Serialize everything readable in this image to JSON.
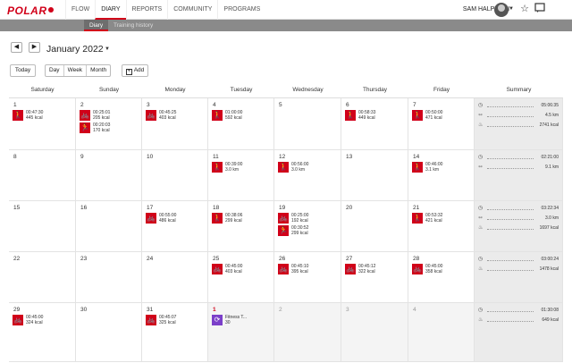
{
  "nav": {
    "logo": "POLAR",
    "items": [
      "FLOW",
      "DIARY",
      "REPORTS",
      "COMMUNITY",
      "PROGRAMS"
    ],
    "user": "SAM HALPERIN"
  },
  "subnav": {
    "items": [
      "Diary",
      "Training history"
    ]
  },
  "controls": {
    "month": "January 2022",
    "today": "Today",
    "views": [
      "Day",
      "Week",
      "Month"
    ],
    "add": "Add"
  },
  "weekdays": [
    "Saturday",
    "Sunday",
    "Monday",
    "Tuesday",
    "Wednesday",
    "Thursday",
    "Friday",
    "Summary"
  ],
  "weeks": [
    {
      "days": [
        {
          "num": "1",
          "ex": [
            {
              "icon": "walking-icon",
              "lines": [
                "00:47:30",
                "445 kcal"
              ]
            }
          ]
        },
        {
          "num": "2",
          "ex": [
            {
              "icon": "cycling-icon",
              "lines": [
                "00:25:01",
                "205 kcal"
              ]
            },
            {
              "icon": "running-icon",
              "lines": [
                "00:20:03",
                "170 kcal"
              ]
            }
          ]
        },
        {
          "num": "3",
          "ex": [
            {
              "icon": "cycling-icon",
              "lines": [
                "00:45:25",
                "403 kcal"
              ]
            }
          ]
        },
        {
          "num": "4",
          "ex": [
            {
              "icon": "walking-icon",
              "lines": [
                "01:00:00",
                "592 kcal"
              ]
            }
          ]
        },
        {
          "num": "5",
          "ex": []
        },
        {
          "num": "6",
          "ex": [
            {
              "icon": "walking-icon",
              "lines": [
                "00:58:33",
                "449 kcal"
              ]
            }
          ]
        },
        {
          "num": "7",
          "ex": [
            {
              "icon": "walking-icon",
              "lines": [
                "00:50:00",
                "471 kcal"
              ]
            }
          ]
        }
      ],
      "summary": [
        {
          "icon": "stopwatch-icon",
          "value": "05:06:35"
        },
        {
          "icon": "distance-icon",
          "value": "4.5 km"
        },
        {
          "icon": "flame-icon",
          "value": "2741 kcal"
        }
      ]
    },
    {
      "days": [
        {
          "num": "8",
          "ex": []
        },
        {
          "num": "9",
          "ex": []
        },
        {
          "num": "10",
          "ex": []
        },
        {
          "num": "11",
          "ex": [
            {
              "icon": "walking-icon",
              "lines": [
                "00:39:00",
                "3.0 km"
              ]
            }
          ]
        },
        {
          "num": "12",
          "ex": [
            {
              "icon": "walking-icon",
              "lines": [
                "00:56:00",
                "3.0 km"
              ]
            }
          ]
        },
        {
          "num": "13",
          "ex": []
        },
        {
          "num": "14",
          "ex": [
            {
              "icon": "walking-icon",
              "lines": [
                "00:46:00",
                "3.1 km"
              ]
            }
          ]
        }
      ],
      "summary": [
        {
          "icon": "stopwatch-icon",
          "value": "02:21:00"
        },
        {
          "icon": "distance-icon",
          "value": "9.1 km"
        }
      ]
    },
    {
      "days": [
        {
          "num": "15",
          "ex": []
        },
        {
          "num": "16",
          "ex": []
        },
        {
          "num": "17",
          "ex": [
            {
              "icon": "cycling-icon",
              "lines": [
                "00:55:00",
                "486 kcal"
              ]
            }
          ]
        },
        {
          "num": "18",
          "ex": [
            {
              "icon": "walking-icon",
              "lines": [
                "00:38:06",
                "299 kcal"
              ]
            }
          ]
        },
        {
          "num": "19",
          "ex": [
            {
              "icon": "cycling-icon",
              "lines": [
                "00:25:00",
                "192 kcal"
              ]
            },
            {
              "icon": "running-icon",
              "lines": [
                "00:30:52",
                "299 kcal"
              ]
            }
          ]
        },
        {
          "num": "20",
          "ex": []
        },
        {
          "num": "21",
          "ex": [
            {
              "icon": "walking-icon",
              "lines": [
                "00:53:32",
                "421 kcal"
              ]
            }
          ]
        }
      ],
      "summary": [
        {
          "icon": "stopwatch-icon",
          "value": "03:22:34"
        },
        {
          "icon": "distance-icon",
          "value": "3.0 km"
        },
        {
          "icon": "flame-icon",
          "value": "1697 kcal"
        }
      ]
    },
    {
      "days": [
        {
          "num": "22",
          "ex": []
        },
        {
          "num": "23",
          "ex": []
        },
        {
          "num": "24",
          "ex": []
        },
        {
          "num": "25",
          "ex": [
            {
              "icon": "cycling-icon",
              "lines": [
                "00:45:00",
                "403 kcal"
              ]
            }
          ]
        },
        {
          "num": "26",
          "ex": [
            {
              "icon": "cycling-icon",
              "lines": [
                "00:45:10",
                "395 kcal"
              ]
            }
          ]
        },
        {
          "num": "27",
          "ex": [
            {
              "icon": "cycling-icon",
              "lines": [
                "00:45:12",
                "322 kcal"
              ]
            }
          ]
        },
        {
          "num": "28",
          "ex": [
            {
              "icon": "cycling-icon",
              "lines": [
                "00:45:00",
                "358 kcal"
              ]
            }
          ]
        }
      ],
      "summary": [
        {
          "icon": "stopwatch-icon",
          "value": "03:00:24"
        },
        {
          "icon": "flame-icon",
          "value": "1478 kcal"
        }
      ]
    },
    {
      "days": [
        {
          "num": "29",
          "ex": [
            {
              "icon": "cycling-icon",
              "lines": [
                "00:45:00",
                "324 kcal"
              ]
            }
          ]
        },
        {
          "num": "30",
          "ex": []
        },
        {
          "num": "31",
          "ex": [
            {
              "icon": "cycling-icon",
              "lines": [
                "00:45:07",
                "325 kcal"
              ]
            }
          ]
        },
        {
          "num": "1",
          "today": true,
          "ex": [
            {
              "icon": "fitness-test-icon",
              "purple": true,
              "lines": [
                "Fitness T...",
                "30"
              ]
            }
          ]
        },
        {
          "num": "2",
          "muted": true,
          "ex": []
        },
        {
          "num": "3",
          "muted": true,
          "ex": []
        },
        {
          "num": "4",
          "muted": true,
          "ex": []
        }
      ],
      "summary": [
        {
          "icon": "stopwatch-icon",
          "value": "01:30:08"
        },
        {
          "icon": "flame-icon",
          "value": "649 kcal"
        }
      ]
    }
  ]
}
